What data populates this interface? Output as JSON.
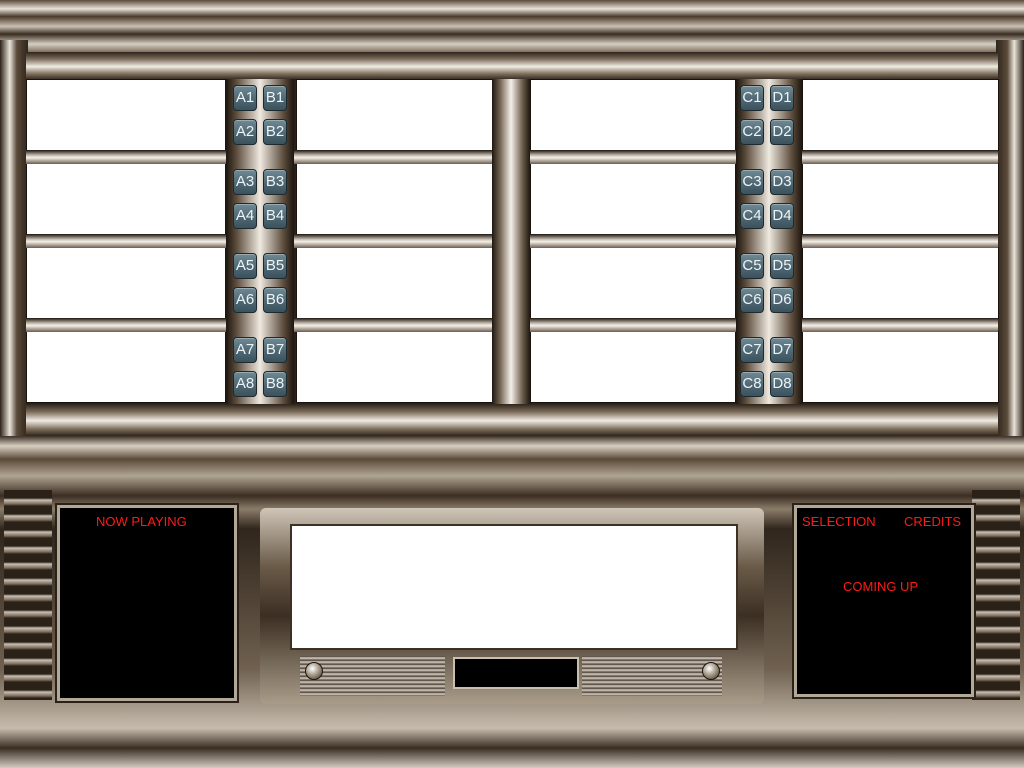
{
  "jukebox": {
    "buttons_left_col1": [
      "A1",
      "A2",
      "A3",
      "A4",
      "A5",
      "A6",
      "A7",
      "A8"
    ],
    "buttons_left_col2": [
      "B1",
      "B2",
      "B3",
      "B4",
      "B5",
      "B6",
      "B7",
      "B8"
    ],
    "buttons_right_col1": [
      "C1",
      "C2",
      "C3",
      "C4",
      "C5",
      "C6",
      "C7",
      "C8"
    ],
    "buttons_right_col2": [
      "D1",
      "D2",
      "D3",
      "D4",
      "D5",
      "D6",
      "D7",
      "D8"
    ]
  },
  "now_playing_panel": {
    "label": "NOW PLAYING"
  },
  "queue_panel": {
    "selection_label": "SELECTION",
    "credits_label": "CREDITS",
    "coming_up_label": "COMING UP"
  },
  "colors": {
    "button_face": "#4c6570",
    "label_red": "#ff1a1a",
    "slip_white": "#ffffff"
  }
}
